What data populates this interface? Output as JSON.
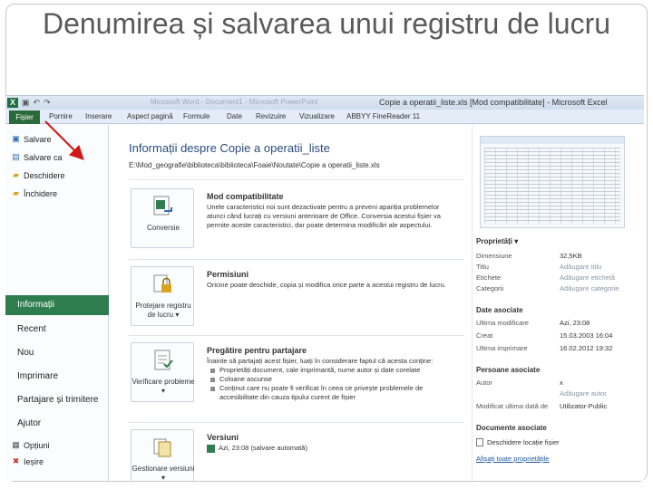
{
  "slide": {
    "title": "Denumirea și salvarea unui registru de lucru"
  },
  "window": {
    "title": "Copie a operatii_liste.xls [Mod compatibilitate] - Microsoft Excel",
    "faint_title": "Microsoft Word - Document1 - Microsoft PowerPoint",
    "qat_icons": [
      "save-icon",
      "undo-icon",
      "redo-icon"
    ]
  },
  "ribbon": {
    "file_tab": "Fișier",
    "tabs": [
      "Pornire",
      "Inserare",
      "Aspect pagină",
      "Formule",
      "Date",
      "Revizuire",
      "Vizualizare",
      "ABBYY FineReader 11"
    ]
  },
  "sidebar": {
    "items": [
      {
        "label": "Salvare",
        "icon": "save-icon"
      },
      {
        "label": "Salvare ca",
        "icon": "save-as-icon"
      },
      {
        "label": "Deschidere",
        "icon": "open-folder-icon"
      },
      {
        "label": "Închidere",
        "icon": "close-folder-icon"
      }
    ],
    "active": "Informații",
    "big_items": [
      "Recent",
      "Nou",
      "Imprimare",
      "Partajare și trimitere",
      "Ajutor"
    ],
    "bottom_items": [
      {
        "label": "Opțiuni",
        "icon": "options-icon"
      },
      {
        "label": "Ieșire",
        "icon": "exit-icon"
      }
    ]
  },
  "info": {
    "title": "Informații despre Copie a operatii_liste",
    "path": "E:\\Mod_geografie\\biblioteca\\biblioteca\\Foaie\\Noutate\\Copie a operatii_liste.xls",
    "sections": {
      "compat": {
        "button": "Conversie",
        "heading": "Mod compatibilitate",
        "description": "Unele caracteristici noi sunt dezactivate pentru a preveni apariția problemelor atunci când lucrați cu versiuni anterioare de Office. Conversia acestui fișier va permite aceste caracteristici, dar poate determina modificări ale aspectului."
      },
      "perm": {
        "button": "Protejare registru de lucru ▾",
        "heading": "Permisiuni",
        "description": "Oricine poate deschide, copia și modifica orice parte a acestui registru de lucru."
      },
      "share": {
        "button": "Verificare probleme ▾",
        "heading": "Pregătire pentru partajare",
        "description": "Înainte să partajați acest fișier, luați în considerare faptul că acesta conține:",
        "bullets": [
          "Proprietăți document, cale imprimantă, nume autor și date corelate",
          "Coloane ascunse",
          "Conținut care nu poate fi verificat în ceea ce privește problemele de accesibilitate din cauza tipului curent de fișier"
        ]
      },
      "versions": {
        "button": "Gestionare versiuni ▾",
        "heading": "Versiuni",
        "entry": "Azi, 23:08 (salvare automată)"
      }
    }
  },
  "props": {
    "heading": "Proprietăți ▾",
    "rows": [
      {
        "key": "Dimensiune",
        "value": "32,5KB",
        "muted": false
      },
      {
        "key": "Titlu",
        "value": "Adăugare titlu",
        "muted": true
      },
      {
        "key": "Etichete",
        "value": "Adăugare etichetă",
        "muted": true
      },
      {
        "key": "Categorii",
        "value": "Adăugare categorie",
        "muted": true
      }
    ],
    "dates_heading": "Date asociate",
    "date_rows": [
      {
        "key": "Ultima modificare",
        "value": "Azi, 23:08"
      },
      {
        "key": "Creat",
        "value": "15.03.2003 16:04"
      },
      {
        "key": "Ultima imprimare",
        "value": "16.02.2012 19:32"
      }
    ],
    "people_heading": "Persoane asociate",
    "people_rows": [
      {
        "key": "Autor",
        "value": "x"
      },
      {
        "key": "",
        "value": "Adăugare autor"
      },
      {
        "key": "Modificat ultima dată de",
        "value": "Utilizator-Public"
      }
    ],
    "docs_heading": "Documente asociate",
    "docs_link": "Deschidere locație fișier",
    "all_props": "Afișați toate proprietățile"
  },
  "colors": {
    "file_tab": "#2a6a3a",
    "active_item": "#2e7d4f",
    "arrow": "#d01818",
    "title_text": "#2a4b7c"
  }
}
